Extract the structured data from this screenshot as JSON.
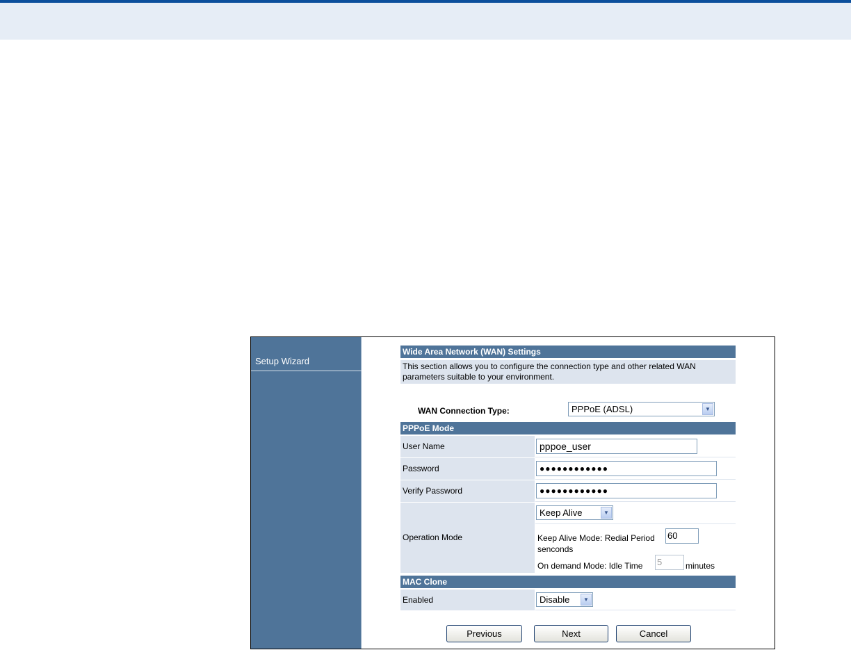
{
  "sidebar": {
    "items": [
      {
        "label": "Setup Wizard"
      }
    ]
  },
  "wan": {
    "header": "Wide Area Network (WAN) Settings",
    "description": "This section allows you to configure the connection type and other related WAN parameters suitable to your environment.",
    "connection_type_label": "WAN Connection Type:",
    "connection_type_value": "PPPoE (ADSL)"
  },
  "pppoe": {
    "header": "PPPoE Mode",
    "user_name_label": "User Name",
    "user_name_value": "pppoe_user",
    "password_label": "Password",
    "password_value": "●●●●●●●●●●●●",
    "verify_password_label": "Verify Password",
    "verify_password_value": "●●●●●●●●●●●●",
    "operation_mode_label": "Operation Mode",
    "operation_mode_value": "Keep Alive",
    "keep_alive_text": "Keep Alive Mode: Redial Period",
    "keep_alive_value": "60",
    "keep_alive_unit": "senconds",
    "on_demand_text": "On demand Mode: Idle Time",
    "on_demand_value": "5",
    "on_demand_unit": "minutes"
  },
  "mac_clone": {
    "header": "MAC Clone",
    "enabled_label": "Enabled",
    "enabled_value": "Disable"
  },
  "buttons": {
    "previous": "Previous",
    "next": "Next",
    "cancel": "Cancel"
  },
  "colors": {
    "header_bar": "#4f7499",
    "label_bg": "#dde4ee",
    "top_rule": "#0b4f9c"
  },
  "icons": {
    "dropdown": "chevron-down-icon"
  }
}
